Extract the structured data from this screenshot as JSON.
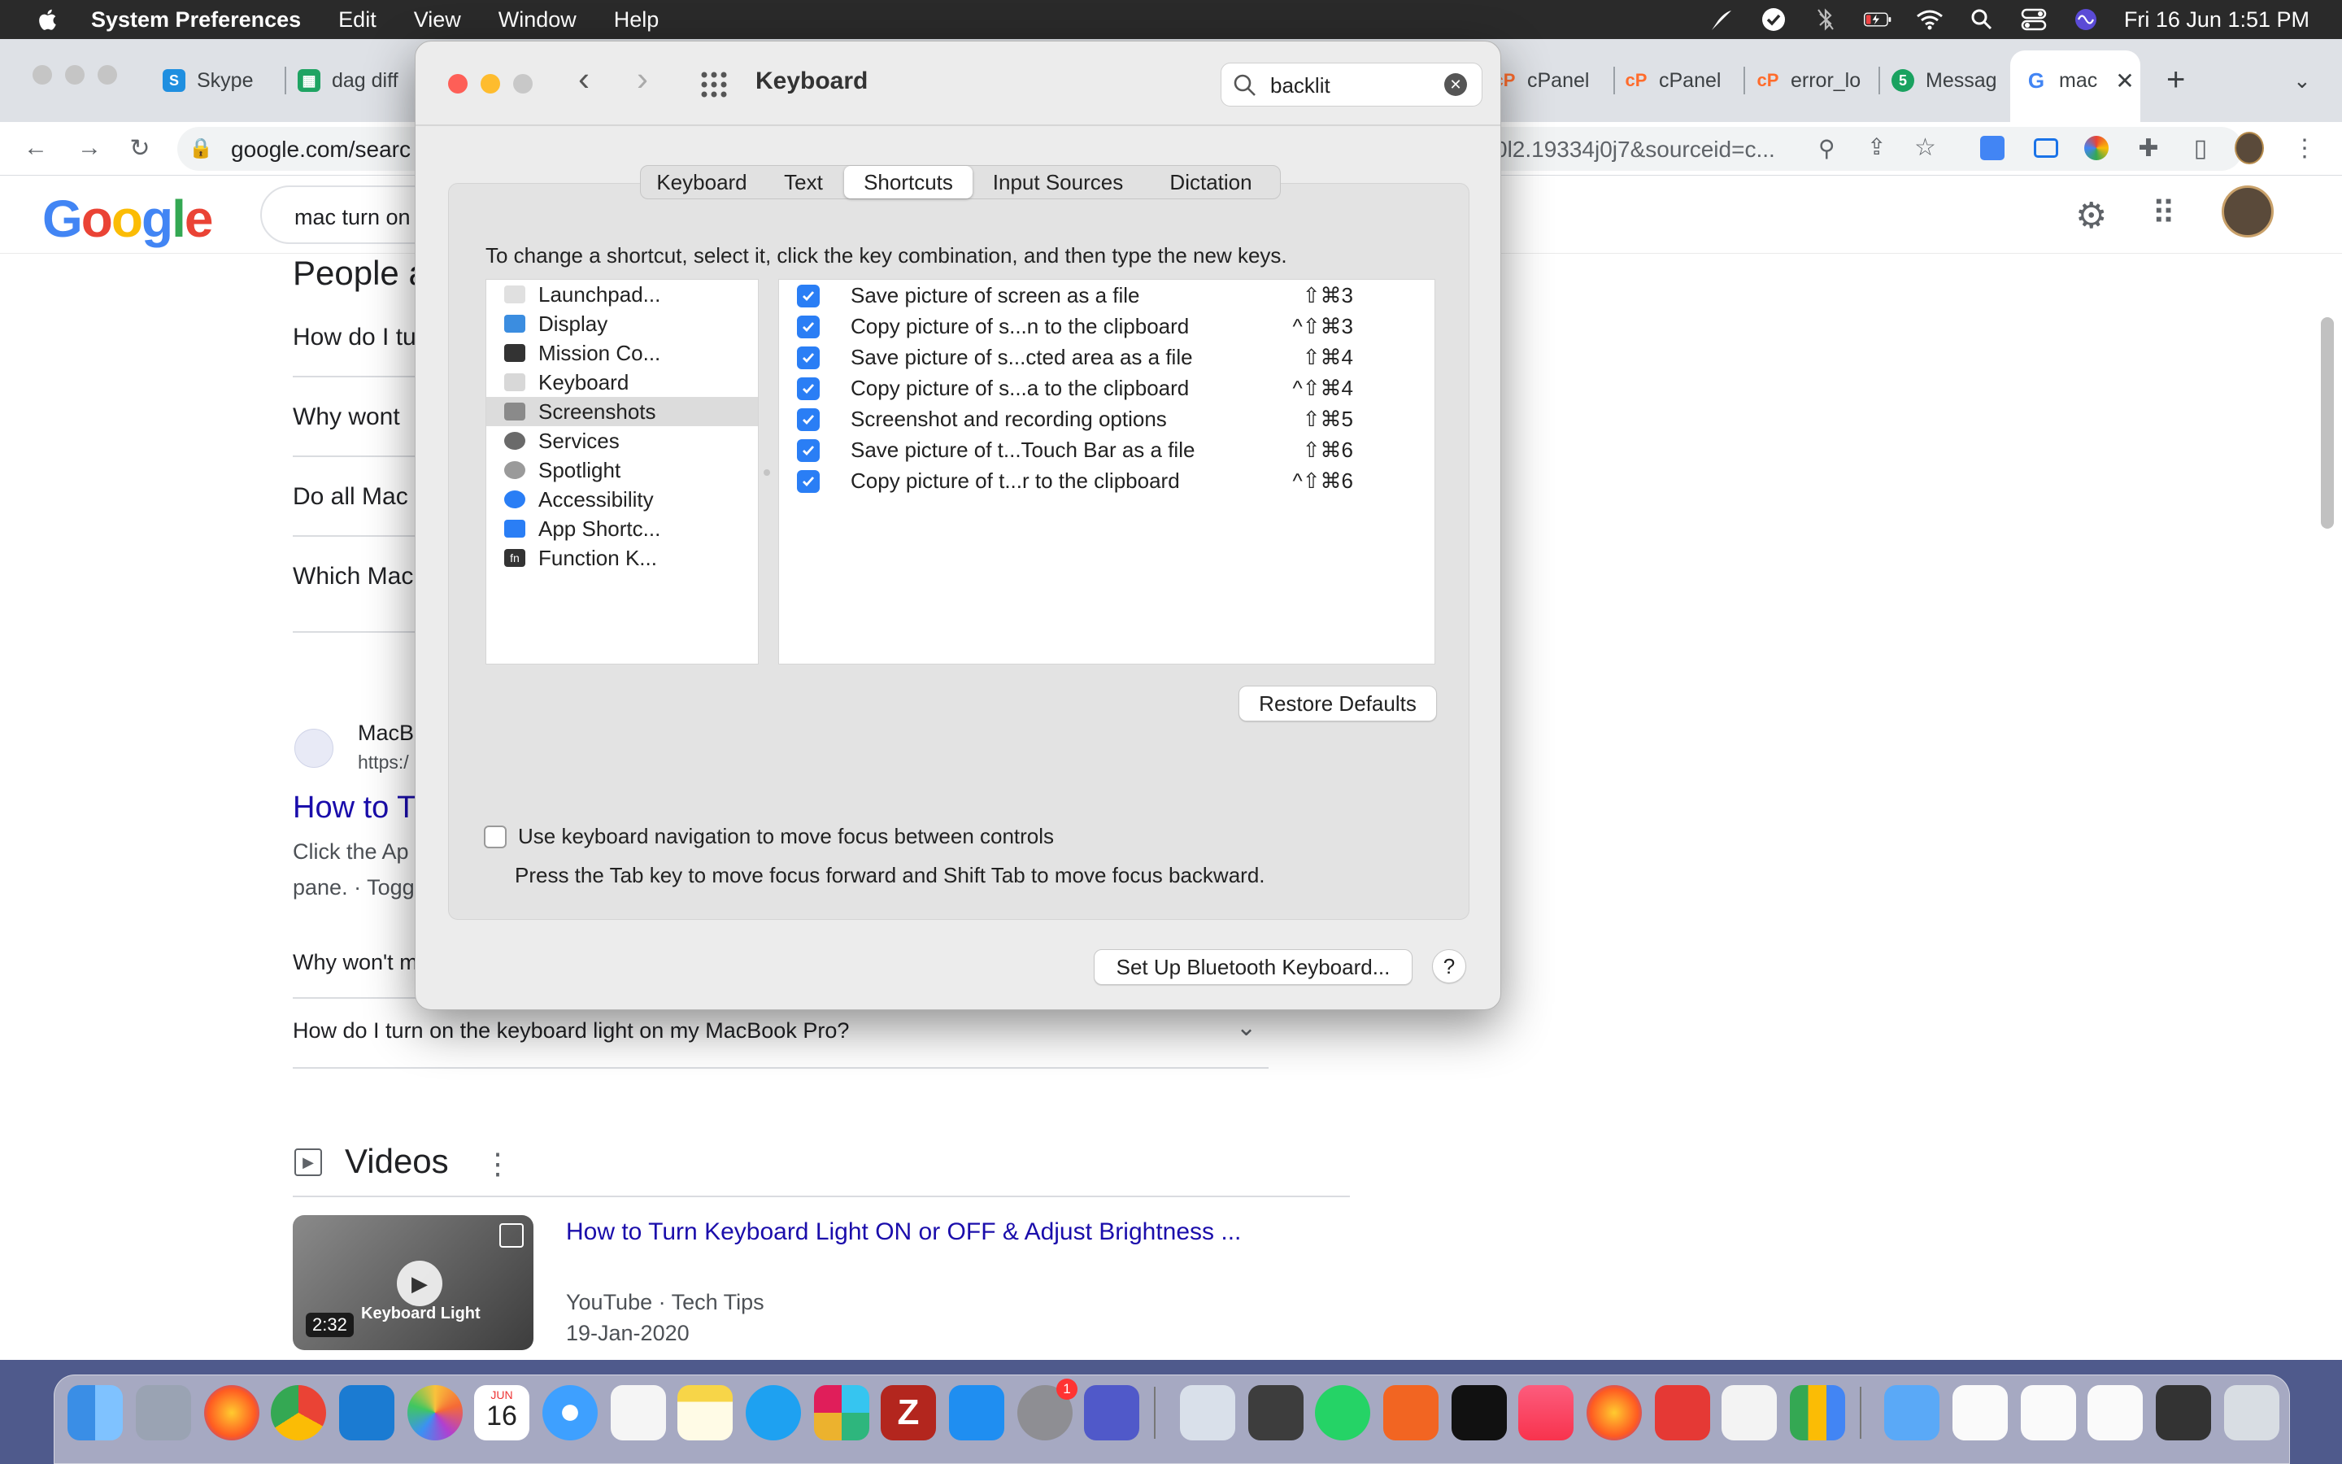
{
  "menubar": {
    "app": "System Preferences",
    "items": [
      "Edit",
      "View",
      "Window",
      "Help"
    ],
    "clock": "Fri 16 Jun  1:51 PM"
  },
  "browser": {
    "tabs": [
      {
        "label": "Skype",
        "icon": "skype-icon"
      },
      {
        "label": "dag diff",
        "icon": "sheets-icon"
      },
      {
        "label": "cPanel",
        "icon": "cpanel-icon"
      },
      {
        "label": "cPanel",
        "icon": "cpanel-icon"
      },
      {
        "label": "error_lo",
        "icon": "cpanel-icon"
      },
      {
        "label": "Messag",
        "icon": "messages-icon"
      },
      {
        "label": "mac",
        "icon": "google-icon"
      }
    ],
    "url_left": "google.com/searc",
    "url_right": "0l2.19334j0j7&sourceid=c..."
  },
  "google": {
    "logo": "Google",
    "query": "mac turn on",
    "paa_title": "People a",
    "questions": [
      "How do I tu",
      "Why wont",
      "Do all Mac",
      "Which Mac"
    ],
    "result_site": "MacB",
    "result_url": "https:/",
    "result_title": "How to T",
    "result_snippet_1": "Click the Ap",
    "result_snippet_2": "pane. · Togg",
    "sub_q1": "Why won't m",
    "sub_q2": "How do I turn on the keyboard light on my MacBook Pro?",
    "videos_heading": "Videos",
    "video_title": "How to Turn Keyboard Light ON or OFF & Adjust Brightness ...",
    "video_source": "YouTube · Tech Tips",
    "video_date": "19-Jan-2020",
    "video_duration": "2:32",
    "video_thumb_caption": "Keyboard Light"
  },
  "prefs": {
    "title": "Keyboard",
    "search_value": "backlit",
    "tabs": [
      "Keyboard",
      "Text",
      "Shortcuts",
      "Input Sources",
      "Dictation"
    ],
    "active_tab": "Shortcuts",
    "instruction": "To change a shortcut, select it, click the key combination, and then type the new keys.",
    "categories": [
      {
        "label": "Launchpad...",
        "color": "#e0e0e0"
      },
      {
        "label": "Display",
        "color": "#3b8de0"
      },
      {
        "label": "Mission Co...",
        "color": "#333333"
      },
      {
        "label": "Keyboard",
        "color": "#d8d8d8"
      },
      {
        "label": "Screenshots",
        "color": "#8a8a8a"
      },
      {
        "label": "Services",
        "color": "#6a6a6a"
      },
      {
        "label": "Spotlight",
        "color": "#9a9a9a"
      },
      {
        "label": "Accessibility",
        "color": "#2a7ef5"
      },
      {
        "label": "App Shortc...",
        "color": "#2a7ef5"
      },
      {
        "label": "Function K...",
        "color": "#333333"
      }
    ],
    "selected_category": "Screenshots",
    "shortcuts": [
      {
        "label": "Save picture of screen as a file",
        "key": "⇧⌘3",
        "checked": true
      },
      {
        "label": "Copy picture of s...n to the clipboard",
        "key": "^⇧⌘3",
        "checked": true
      },
      {
        "label": "Save picture of s...cted area as a file",
        "key": "⇧⌘4",
        "checked": true
      },
      {
        "label": "Copy picture of s...a to the clipboard",
        "key": "^⇧⌘4",
        "checked": true
      },
      {
        "label": "Screenshot and recording options",
        "key": "⇧⌘5",
        "checked": true
      },
      {
        "label": "Save picture of t...Touch Bar as a file",
        "key": "⇧⌘6",
        "checked": true
      },
      {
        "label": "Copy picture of t...r to the clipboard",
        "key": "^⇧⌘6",
        "checked": true
      }
    ],
    "restore_defaults": "Restore Defaults",
    "kbnav_label": "Use keyboard navigation to move focus between controls",
    "kbnav_hint": "Press the Tab key to move focus forward and Shift Tab to move focus backward.",
    "bluetooth_button": "Set Up Bluetooth Keyboard...",
    "help_button": "?"
  },
  "dock": {
    "calendar_month": "JUN",
    "calendar_day": "16",
    "badge_sysprefs": "1"
  },
  "colors": {
    "accent": "#2a7ef5",
    "link": "#1a0dab",
    "close": "#fe5f57",
    "minimize": "#febc2e",
    "zoom": "#c8c8c8"
  }
}
